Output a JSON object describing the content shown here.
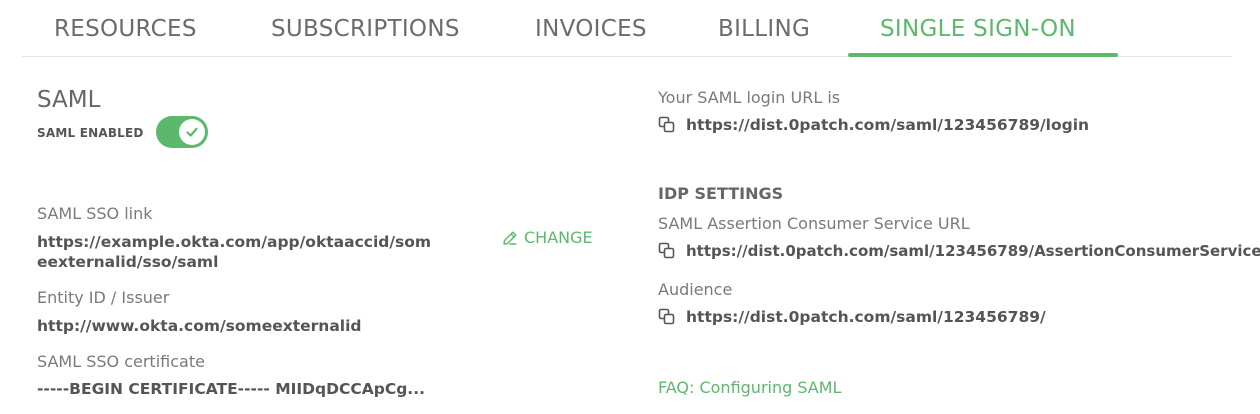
{
  "tabs": [
    {
      "label": "RESOURCES"
    },
    {
      "label": "SUBSCRIPTIONS"
    },
    {
      "label": "INVOICES"
    },
    {
      "label": "BILLING"
    },
    {
      "label": "SINGLE SIGN-ON",
      "active": true
    }
  ],
  "saml": {
    "title": "SAML",
    "enabled_label": "SAML ENABLED",
    "enabled": true,
    "sso_link_label": "SAML SSO link",
    "sso_link_line1": "https://example.okta.com/app/oktaaccid/som",
    "sso_link_line2": "eexternalid/sso/saml",
    "change_label": "CHANGE",
    "entity_label": "Entity ID / Issuer",
    "entity_value": "http://www.okta.com/someexternalid",
    "cert_label": "SAML SSO certificate",
    "cert_value": "-----BEGIN CERTIFICATE----- MIIDqDCCApCg..."
  },
  "login": {
    "label": "Your SAML login URL is",
    "url": "https://dist.0patch.com/saml/123456789/login"
  },
  "idp": {
    "title": "IDP SETTINGS",
    "acs_label": "SAML Assertion Consumer Service URL",
    "acs_url": "https://dist.0patch.com/saml/123456789/AssertionConsumerService",
    "audience_label": "Audience",
    "audience_url": "https://dist.0patch.com/saml/123456789/"
  },
  "faq": {
    "label": "FAQ: Configuring SAML"
  },
  "colors": {
    "accent": "#5cb86b",
    "text": "#555555"
  }
}
